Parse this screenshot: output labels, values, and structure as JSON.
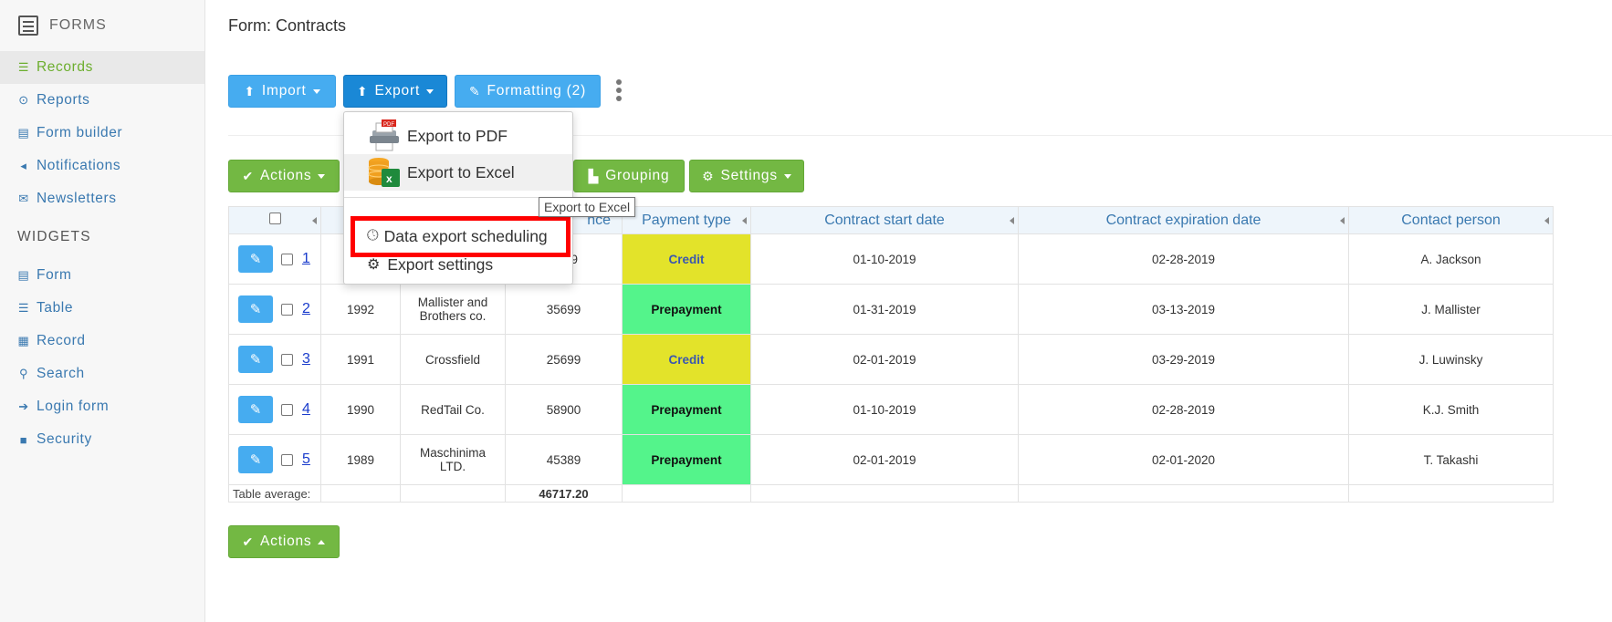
{
  "sidebar": {
    "header": "FORMS",
    "items": [
      {
        "label": "Records",
        "icon": "list-icon"
      },
      {
        "label": "Reports",
        "icon": "target-icon"
      },
      {
        "label": "Form builder",
        "icon": "form-icon"
      },
      {
        "label": "Notifications",
        "icon": "megaphone-icon"
      },
      {
        "label": "Newsletters",
        "icon": "envelope-icon"
      }
    ],
    "widgets_header": "WIDGETS",
    "widgets": [
      {
        "label": "Form",
        "icon": "form-icon"
      },
      {
        "label": "Table",
        "icon": "list-icon"
      },
      {
        "label": "Record",
        "icon": "document-icon"
      },
      {
        "label": "Search",
        "icon": "search-icon"
      },
      {
        "label": "Login form",
        "icon": "login-icon"
      },
      {
        "label": "Security",
        "icon": "lock-icon"
      }
    ]
  },
  "page": {
    "title": "Form: Contracts"
  },
  "toolbar": {
    "import_label": "Import",
    "export_label": "Export",
    "formatting_label": "Formatting (2)",
    "actions_label": "Actions",
    "grouping_label": "Grouping",
    "settings_label": "Settings"
  },
  "export_menu": {
    "pdf": "Export to PDF",
    "excel": "Export to Excel",
    "scheduling": "Data export scheduling",
    "settings": "Export settings"
  },
  "tooltip": "Export to Excel",
  "table": {
    "headers": {
      "price_partial": "nce",
      "payment": "Payment type",
      "start": "Contract start date",
      "expiration": "Contract expiration date",
      "contact": "Contact person"
    },
    "rows": [
      {
        "id": "1",
        "year": "",
        "company": "",
        "price": "9",
        "payment": "Credit",
        "start": "01-10-2019",
        "end": "02-28-2019",
        "contact": "A. Jackson"
      },
      {
        "id": "2",
        "year": "1992",
        "company": "Mallister and Brothers co.",
        "price": "35699",
        "payment": "Prepayment",
        "start": "01-31-2019",
        "end": "03-13-2019",
        "contact": "J. Mallister"
      },
      {
        "id": "3",
        "year": "1991",
        "company": "Crossfield",
        "price": "25699",
        "payment": "Credit",
        "start": "02-01-2019",
        "end": "03-29-2019",
        "contact": "J. Luwinsky"
      },
      {
        "id": "4",
        "year": "1990",
        "company": "RedTail Co.",
        "price": "58900",
        "payment": "Prepayment",
        "start": "01-10-2019",
        "end": "02-28-2019",
        "contact": "K.J. Smith"
      },
      {
        "id": "5",
        "year": "1989",
        "company": "Maschinima LTD.",
        "price": "45389",
        "payment": "Prepayment",
        "start": "02-01-2019",
        "end": "02-01-2020",
        "contact": "T. Takashi"
      }
    ],
    "footer_label": "Table average:",
    "footer_avg": "46717.20"
  },
  "colors": {
    "accent_green": "#73b843",
    "accent_blue": "#46acf0",
    "credit": "#e3e32a",
    "prepayment": "#54f48b",
    "highlight": "#ff0000"
  }
}
